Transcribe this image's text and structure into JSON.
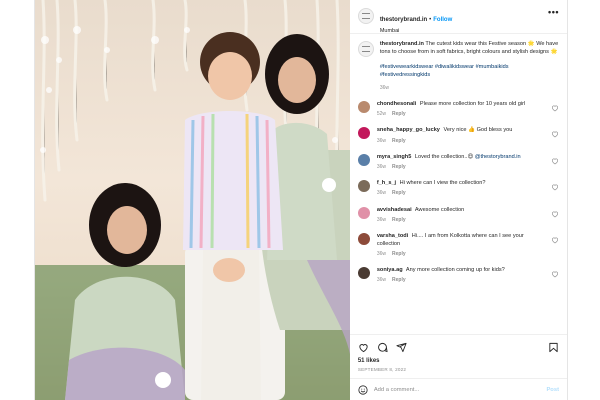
{
  "post": {
    "username": "thestorybrand.in",
    "separator": "•",
    "follow_label": "Follow",
    "location": "Mumbai",
    "more_label": "•••"
  },
  "caption": {
    "username": "thestorybrand.in",
    "text": "The cutest kids wear this Festive season 🌟 We have tons to choose from in soft fabrics, bright colours and stylish designs 🌟",
    "hashtags": "#festivewearkidswear #diwalikidswear #mumbaikids #festivedressingkids",
    "time": "36w"
  },
  "comments": [
    {
      "user": "chondhesonali",
      "text": "Please more collection for 10 years old girl",
      "time": "52w",
      "reply": "Reply",
      "avatar_color": "#b98a6e"
    },
    {
      "user": "sneha_happy_go_lucky",
      "text": "Very nice 👍 God bless you",
      "time": "36w",
      "reply": "Reply",
      "avatar_color": "#c2185b"
    },
    {
      "user": "myra_singh5",
      "text": "Loved the collection..😍",
      "mention": "@thestorybrand.in",
      "time": "36w",
      "reply": "Reply",
      "avatar_color": "#5a7fa8"
    },
    {
      "user": "f_h_s_j",
      "text": "Hi where can I view the collection?",
      "time": "36w",
      "reply": "Reply",
      "avatar_color": "#7b6b5a"
    },
    {
      "user": "avvishadesai",
      "text": "Awesome collection",
      "time": "36w",
      "reply": "Reply",
      "avatar_color": "#e091a8"
    },
    {
      "user": "varsha_todi",
      "text": "Hi.... I am from Kolkotta where can I see your collection",
      "time": "36w",
      "reply": "Reply",
      "avatar_color": "#8d4b3a"
    },
    {
      "user": "soniya.ag",
      "text": "Any more collection coming up for kids?",
      "time": "36w",
      "reply": "Reply",
      "avatar_color": "#4a3b33"
    }
  ],
  "actions": {
    "likes": "51 likes",
    "date": "SEPTEMBER 8, 2022"
  },
  "add_comment": {
    "placeholder": "Add a comment...",
    "post_label": "Post"
  },
  "icons": {
    "like": "heart-icon",
    "comment": "comment-icon",
    "share": "share-icon",
    "save": "bookmark-icon",
    "emoji": "smiley-icon"
  },
  "colors": {
    "follow": "#0095f6",
    "hashtag": "#00376b",
    "muted": "#8e8e8e",
    "post_disabled": "#b2dffc"
  }
}
